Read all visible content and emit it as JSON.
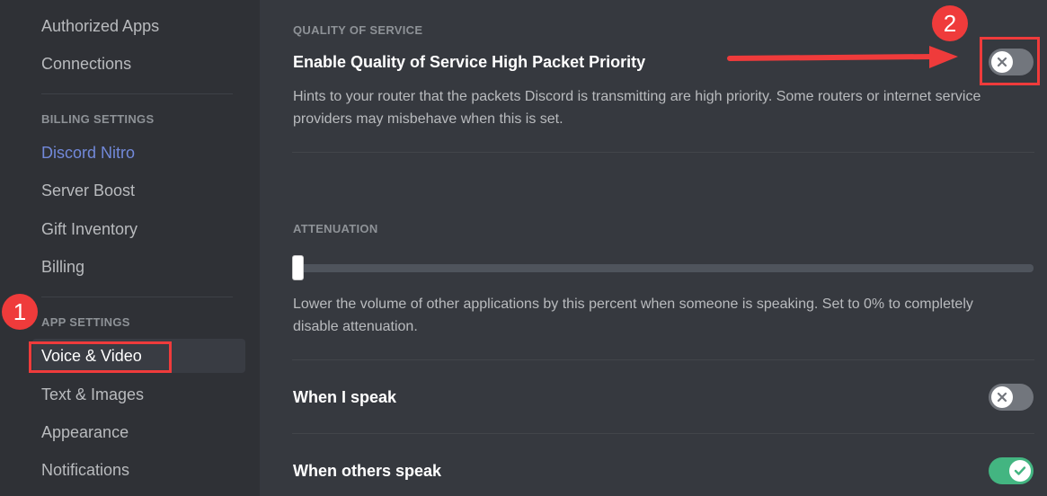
{
  "sidebar": {
    "items_top": [
      {
        "label": "Authorized Apps"
      },
      {
        "label": "Connections"
      }
    ],
    "billing_header": "BILLING SETTINGS",
    "billing_items": [
      {
        "label": "Discord Nitro"
      },
      {
        "label": "Server Boost"
      },
      {
        "label": "Gift Inventory"
      },
      {
        "label": "Billing"
      }
    ],
    "app_header": "APP SETTINGS",
    "app_items": [
      {
        "label": "Voice & Video",
        "selected": true
      },
      {
        "label": "Text & Images"
      },
      {
        "label": "Appearance"
      },
      {
        "label": "Notifications"
      }
    ]
  },
  "main": {
    "qos": {
      "section_title": "QUALITY OF SERVICE",
      "setting_title": "Enable Quality of Service High Packet Priority",
      "description": "Hints to your router that the packets Discord is transmitting are high priority. Some routers or internet service providers may misbehave when this is set.",
      "enabled": false
    },
    "attenuation": {
      "section_title": "ATTENUATION",
      "value_percent": 0,
      "description": "Lower the volume of other applications by this percent when someone is speaking. Set to 0% to completely disable attenuation.",
      "when_i_speak": {
        "label": "When I speak",
        "enabled": false
      },
      "when_others_speak": {
        "label": "When others speak",
        "enabled": true
      }
    }
  },
  "annotations": {
    "step1": "1",
    "step2": "2",
    "color": "#ef3b3b"
  },
  "colors": {
    "toggle_off": "#72767d",
    "toggle_on": "#43b581",
    "nitro_link": "#7289da"
  }
}
